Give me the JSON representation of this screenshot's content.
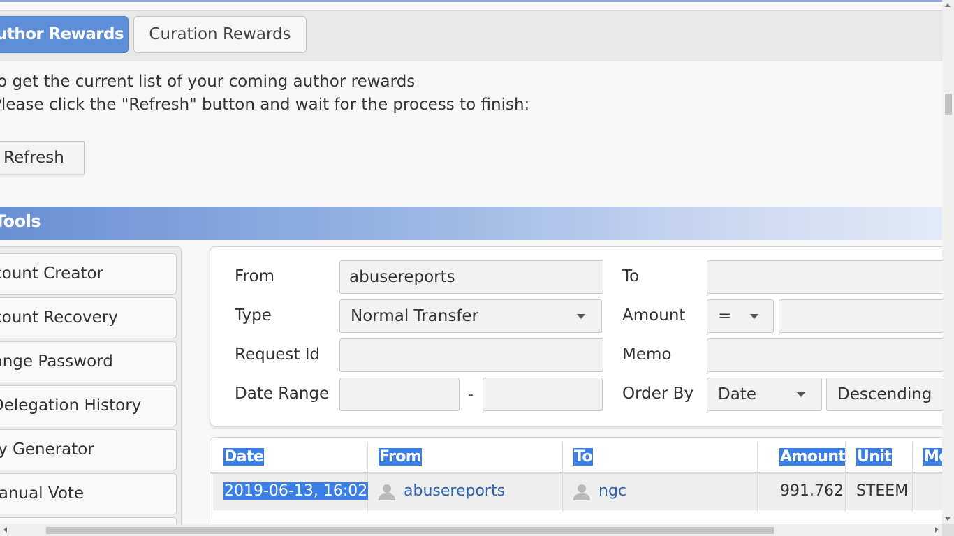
{
  "tabs": {
    "author_rewards": "Author Rewards",
    "curation_rewards": "Curation Rewards"
  },
  "intro": {
    "line1": "To get the current list of your coming author rewards",
    "line2": "Please click the \"Refresh\" button and wait for the process to finish:",
    "refresh_button": "Refresh"
  },
  "tools": {
    "title": "Tools",
    "items": [
      {
        "label": "Account Creator"
      },
      {
        "label": "Account Recovery"
      },
      {
        "label": "Change Password"
      },
      {
        "label": "Delegation History"
      },
      {
        "label": "Key Generator"
      },
      {
        "label": "Manual Vote"
      }
    ]
  },
  "form": {
    "from_label": "From",
    "from_value": "abusereports",
    "to_label": "To",
    "to_value": "",
    "type_label": "Type",
    "type_value": "Normal Transfer",
    "amount_label": "Amount",
    "amount_operator": "=",
    "amount_value": "",
    "request_id_label": "Request Id",
    "request_id_value": "",
    "memo_label": "Memo",
    "memo_value": "",
    "date_range_label": "Date Range",
    "date_range_separator": "-",
    "date_start": "",
    "date_end": "",
    "order_by_label": "Order By",
    "order_by_value": "Date",
    "order_direction": "Descending"
  },
  "table": {
    "headers": {
      "date": "Date",
      "from": "From",
      "to": "To",
      "amount": "Amount",
      "unit": "Unit",
      "memo": "Memo"
    },
    "rows": [
      {
        "date": "2019-06-13, 16:02",
        "from": "abusereports",
        "to": "ngc",
        "amount": "991.762",
        "unit": "STEEM",
        "memo": ""
      }
    ]
  },
  "colors": {
    "accent": "#5e8ed8",
    "selection": "#3b80e8",
    "link": "#2c63b3"
  },
  "icons": {
    "user": "user-icon",
    "caret": "chevron-down-icon"
  }
}
